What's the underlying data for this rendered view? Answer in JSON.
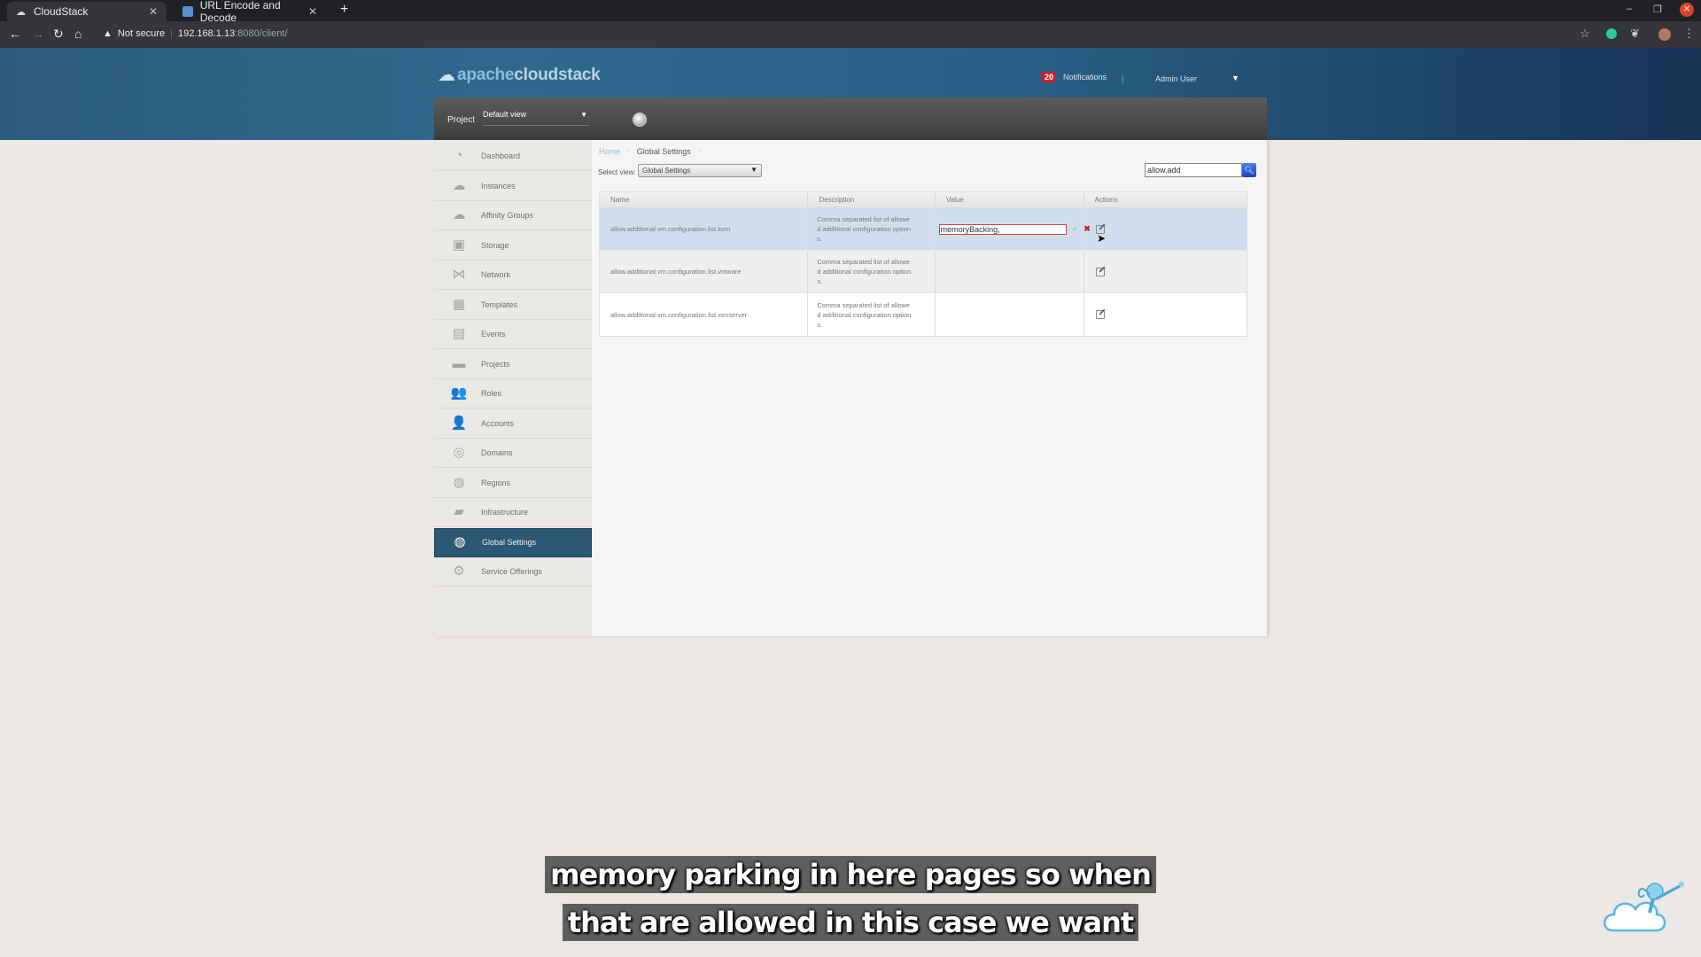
{
  "browser": {
    "tabs": [
      {
        "title": "CloudStack",
        "active": true
      },
      {
        "title": "URL Encode and Decode",
        "active": false
      }
    ],
    "new_tab": "+",
    "security_label": "Not secure",
    "url_host": "192.168.1.13",
    "url_path": ":8080/client/",
    "window_controls": {
      "minimize": "–",
      "restore": "❐",
      "close": "✕"
    }
  },
  "header": {
    "logo_part1": "apache",
    "logo_part2": "cloudstack",
    "notifications_count": "20",
    "notifications_label": "Notifications",
    "separator": "|",
    "user_name": "Admin User"
  },
  "project_bar": {
    "label": "Project",
    "selected": "Default view"
  },
  "sidebar": {
    "items": [
      {
        "label": "Dashboard",
        "icon": "dashboard-icon",
        "glyph": "◔"
      },
      {
        "label": "Instances",
        "icon": "cloud-icon",
        "glyph": "☁"
      },
      {
        "label": "Affinity Groups",
        "icon": "affinity-groups-icon",
        "glyph": "☁"
      },
      {
        "label": "Storage",
        "icon": "storage-icon",
        "glyph": "▣"
      },
      {
        "label": "Network",
        "icon": "network-icon",
        "glyph": "⋈"
      },
      {
        "label": "Templates",
        "icon": "templates-icon",
        "glyph": "▦"
      },
      {
        "label": "Events",
        "icon": "calendar-icon",
        "glyph": "▤"
      },
      {
        "label": "Projects",
        "icon": "folder-icon",
        "glyph": "▬"
      },
      {
        "label": "Roles",
        "icon": "roles-icon",
        "glyph": "👥"
      },
      {
        "label": "Accounts",
        "icon": "user-icon",
        "glyph": "👤"
      },
      {
        "label": "Domains",
        "icon": "domains-icon",
        "glyph": "◎"
      },
      {
        "label": "Regions",
        "icon": "globe-icon",
        "glyph": "◍"
      },
      {
        "label": "Infrastructure",
        "icon": "infrastructure-icon",
        "glyph": "▰"
      },
      {
        "label": "Global Settings",
        "icon": "global-settings-icon",
        "glyph": "◍",
        "active": true
      },
      {
        "label": "Service Offerings",
        "icon": "gear-icon",
        "glyph": "⚙"
      }
    ]
  },
  "breadcrumb": {
    "home": "Home",
    "current": "Global Settings"
  },
  "toolbar": {
    "select_view_label": "Select view:",
    "select_view_value": "Global Settings",
    "search_value": "allow.add"
  },
  "table": {
    "columns": [
      "Name",
      "Description",
      "Value",
      "Actions"
    ],
    "rows": [
      {
        "name": "allow.additional.vm.configuration.list.kvm",
        "description": [
          "Comma separated list of allowe",
          "d additional configuration option",
          "s."
        ],
        "value": "memoryBacking,",
        "editing": true
      },
      {
        "name": "allow.additional.vm.configuration.list.vmware",
        "description": [
          "Comma separated list of allowe",
          "d additional configuration option",
          "s."
        ],
        "value": ""
      },
      {
        "name": "allow.additional.vm.configuration.list.xenserver",
        "description": [
          "Comma separated list of allowe",
          "d additional configuration option",
          "s."
        ],
        "value": ""
      }
    ],
    "confirm_glyph": "✔",
    "cancel_glyph": "✖"
  },
  "subtitles": [
    "memory parking in here pages so when",
    "that are allowed in this case we want"
  ],
  "colors": {
    "header_blue": "#2f6a8e",
    "active_nav": "#2d5875",
    "notif_badge": "#c8202f",
    "selected_row": "#cfdeed",
    "search_button": "#2f55d4"
  }
}
